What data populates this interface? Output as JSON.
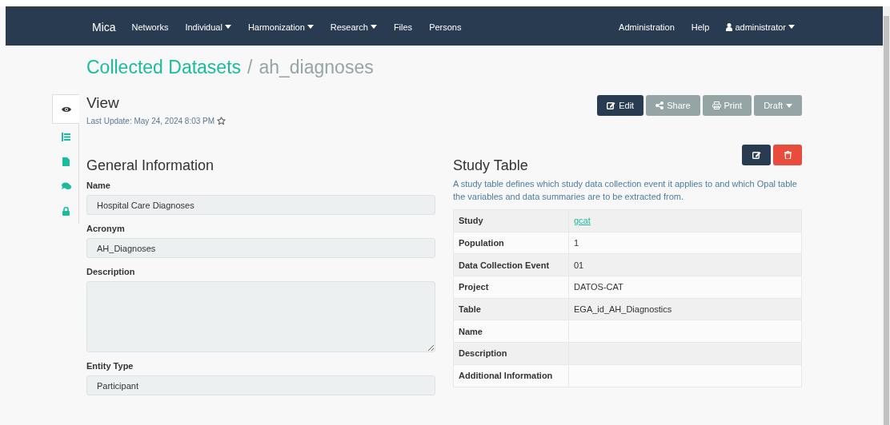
{
  "navbar": {
    "brand": "Mica",
    "items": [
      {
        "label": "Networks",
        "dropdown": false
      },
      {
        "label": "Individual",
        "dropdown": true
      },
      {
        "label": "Harmonization",
        "dropdown": true
      },
      {
        "label": "Research",
        "dropdown": true
      },
      {
        "label": "Files",
        "dropdown": false
      },
      {
        "label": "Persons",
        "dropdown": false
      }
    ],
    "right_items": [
      {
        "label": "Administration",
        "kind": "link",
        "dropdown": false
      },
      {
        "label": "Help",
        "kind": "link",
        "dropdown": false
      },
      {
        "label": "administrator",
        "kind": "user",
        "dropdown": true
      }
    ]
  },
  "breadcrumb": {
    "parent": "Collected Datasets",
    "separator": "/",
    "current": "ah_diagnoses"
  },
  "sidebar": {
    "items": [
      {
        "selected": true
      },
      {
        "selected": false
      },
      {
        "selected": false
      },
      {
        "selected": false
      },
      {
        "selected": false
      }
    ]
  },
  "view": {
    "title": "View",
    "last_update": "Last Update: May 24, 2024 8:03 PM",
    "starred": false
  },
  "actions": [
    {
      "label": "Edit",
      "kind": "edit"
    },
    {
      "label": "Share",
      "kind": "share"
    },
    {
      "label": "Print",
      "kind": "print"
    },
    {
      "label": "Draft",
      "kind": "draft"
    }
  ],
  "general_information": {
    "title": "General Information",
    "fields": [
      {
        "label": "Name",
        "value": "Hospital Care Diagnoses",
        "kind": "input"
      },
      {
        "label": "Acronym",
        "value": "AH_Diagnoses",
        "kind": "input"
      },
      {
        "label": "Description",
        "kind": "textarea"
      },
      {
        "label": "Entity Type",
        "value": "Participant",
        "kind": "input"
      }
    ]
  },
  "study_table": {
    "title": "Study Table",
    "description": "A study table defines which study data collection event it applies to and which Opal table the variables and data summaries are to be extracted from.",
    "rows": [
      {
        "label": "Study",
        "value": "gcat",
        "kind": "link"
      },
      {
        "label": "Population",
        "value": "1",
        "kind": "text"
      },
      {
        "label": "Data Collection Event",
        "value": "01",
        "kind": "text"
      },
      {
        "label": "Project",
        "value": "DATOS-CAT",
        "kind": "text"
      },
      {
        "label": "Table",
        "value": "EGA_id_AH_Diagnostics",
        "kind": "text"
      },
      {
        "label": "Name"
      },
      {
        "label": "Description"
      },
      {
        "label": "Additional Information"
      }
    ]
  }
}
